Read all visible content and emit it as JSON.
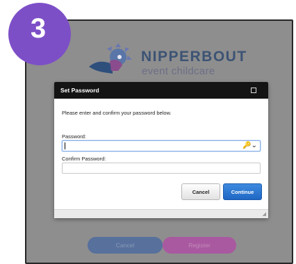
{
  "step": {
    "number": "3"
  },
  "logo": {
    "title": "NIPPERBOUT",
    "subtitle": "event childcare"
  },
  "dialog": {
    "title": "Set Password",
    "intro": "Please enter and confirm your password below.",
    "password_label": "Password:",
    "password_value": "",
    "confirm_label": "Confirm Password:",
    "confirm_value": "",
    "key_icon": "🔑⌄",
    "cancel_label": "Cancel",
    "continue_label": "Continue"
  },
  "page_buttons": {
    "cancel_label": "Cancel",
    "register_label": "Register"
  },
  "colors": {
    "badge": "#7d4fc7",
    "brand_text": "#3c5374",
    "continue": "#2a73d4",
    "page_cancel": "#57709c",
    "page_register": "#a9599f"
  }
}
